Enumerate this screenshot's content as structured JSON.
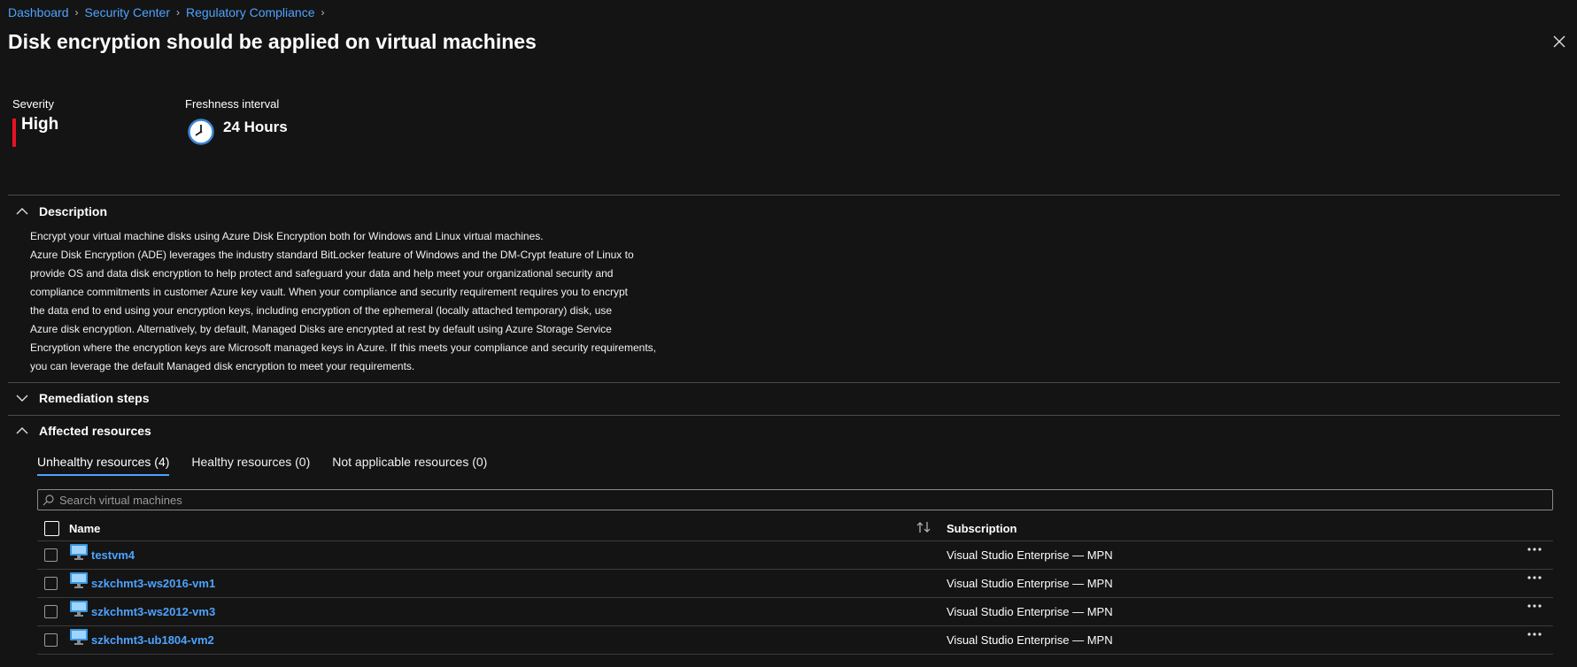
{
  "breadcrumb": [
    "Dashboard",
    "Security Center",
    "Regulatory Compliance"
  ],
  "title": "Disk encryption should be applied on virtual machines",
  "severity": {
    "label": "Severity",
    "value": "High",
    "color": "#e81123"
  },
  "freshness": {
    "label": "Freshness interval",
    "value": "24 Hours",
    "icon": "clock-icon"
  },
  "sections": {
    "description": "Description",
    "remediation": "Remediation steps",
    "affected": "Affected resources"
  },
  "description_lines": [
    "Encrypt your virtual machine disks using Azure Disk Encryption both for Windows and Linux virtual machines.",
    "Azure Disk Encryption (ADE) leverages the industry standard BitLocker feature of Windows and the DM-Crypt feature of Linux to",
    "provide OS and data disk encryption to help protect and safeguard your data and help meet your organizational security and",
    "compliance commitments in customer Azure key vault. When your compliance and security requirement requires you to encrypt",
    "the data end to end using your encryption keys, including encryption of the ephemeral (locally attached temporary) disk, use",
    "Azure disk encryption. Alternatively, by default, Managed Disks are encrypted at rest by default using Azure Storage Service",
    "Encryption where the encryption keys are Microsoft managed keys in Azure. If this meets your compliance and security requirements,",
    "you can leverage the default Managed disk encryption to meet your requirements."
  ],
  "tabs": [
    "Unhealthy resources (4)",
    "Healthy resources (0)",
    "Not applicable resources (0)"
  ],
  "search": {
    "placeholder": "Search virtual machines"
  },
  "table": {
    "headers": {
      "name": "Name",
      "subscription": "Subscription"
    },
    "rows": [
      {
        "name": "testvm4",
        "subscription": "Visual Studio Enterprise — MPN"
      },
      {
        "name": "szkchmt3-ws2016-vm1",
        "subscription": "Visual Studio Enterprise — MPN"
      },
      {
        "name": "szkchmt3-ws2012-vm3",
        "subscription": "Visual Studio Enterprise — MPN"
      },
      {
        "name": "szkchmt3-ub1804-vm2",
        "subscription": "Visual Studio Enterprise — MPN"
      }
    ]
  },
  "colors": {
    "accent": "#4da3ff",
    "background": "#141414",
    "severity_high": "#e81123"
  }
}
